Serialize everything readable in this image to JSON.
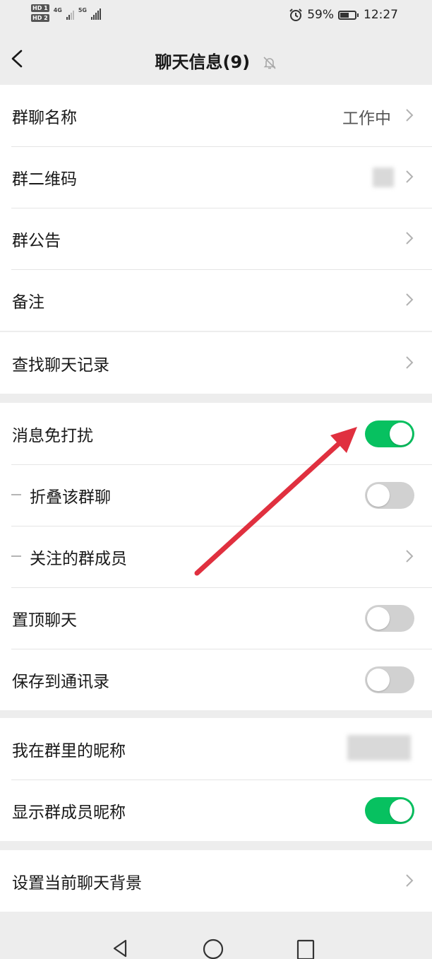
{
  "status_bar": {
    "hd1": "HD 1",
    "hd2": "HD 2",
    "net1": "4G",
    "net2": "5G",
    "battery_percent": "59%",
    "battery_level": 0.59,
    "time": "12:27"
  },
  "header": {
    "title": "聊天信息(9)"
  },
  "sections": {
    "group_info": [
      {
        "label": "群聊名称",
        "value": "工作中"
      },
      {
        "label": "群二维码"
      },
      {
        "label": "群公告"
      },
      {
        "label": "备注"
      }
    ],
    "search": {
      "label": "查找聊天记录"
    },
    "settings": [
      {
        "label": "消息免打扰",
        "on": true
      },
      {
        "label": "折叠该群聊",
        "on": false
      },
      {
        "label": "关注的群成员"
      },
      {
        "label": "置顶聊天",
        "on": false
      },
      {
        "label": "保存到通讯录",
        "on": false
      }
    ],
    "nickname": [
      {
        "label": "我在群里的昵称"
      },
      {
        "label": "显示群成员昵称",
        "on": true
      }
    ],
    "background": {
      "label": "设置当前聊天背景"
    }
  },
  "colors": {
    "toggle_on": "#07c160",
    "toggle_off": "#d1d1d1",
    "annotation_arrow": "#e0303f"
  }
}
